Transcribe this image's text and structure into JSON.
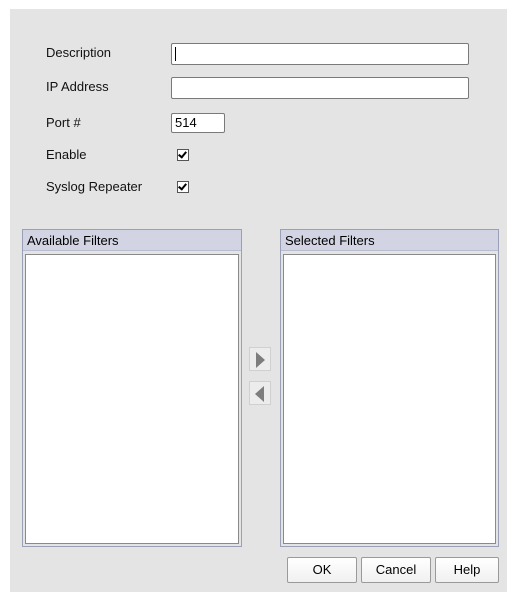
{
  "form": {
    "description_label": "Description",
    "description_value": "",
    "ip_label": "IP Address",
    "ip_value": "",
    "port_label": "Port #",
    "port_value": "514",
    "enable_label": "Enable",
    "enable_checked": true,
    "repeater_label": "Syslog Repeater",
    "repeater_checked": true
  },
  "filters": {
    "available_title": "Available Filters",
    "available_items": [],
    "selected_title": "Selected Filters",
    "selected_items": []
  },
  "buttons": {
    "ok": "OK",
    "cancel": "Cancel",
    "help": "Help"
  }
}
